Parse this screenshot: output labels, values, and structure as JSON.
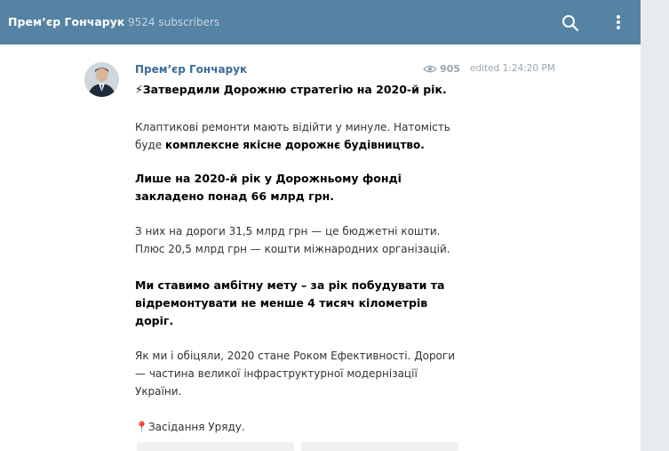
{
  "header": {
    "channel_title": "Прем’єр Гончарук",
    "subscribers": "9524 subscribers",
    "search_icon": "search-icon",
    "menu_icon": "more-vertical-icon",
    "background_color": "#5682a3"
  },
  "post": {
    "author": "Прем’єр Гончарук",
    "views": "905",
    "edited": "edited 1:24:20 PM",
    "heading_emoji": "⚡",
    "heading_text": "Затвердили Дорожню стратегію на 2020-й рік.",
    "para1_line1": "Клаптикові ремонти мають відійти у минуле. Натомість",
    "para1_line2_start": "буде ",
    "para1_line2_bold": "комплексне якісне дорожнє будівництво.",
    "para2_line1": "Лише на 2020-й рік у Дорожньому фонді",
    "para2_line2": "закладено понад 66 млрд грн.",
    "para3_line1": "З них на дороги 31,5 млрд грн — це бюджетні кошти.",
    "para3_line2": "Плюс 20,5 млрд грн — кошти міжнародних організацій.",
    "para4_line1": "Ми ставимо амбітну мету – за рік побудувати та",
    "para4_line2": "відремонтувати не менше 4 тисяч кілометрів",
    "para4_line3": "доріг.",
    "para5_line1": "Як ми і обіцяли, 2020 стане Роком Ефективності. Дороги",
    "para5_line2": "— частина великої інфраструктурної модернізації",
    "para5_line3": "України.",
    "location_emoji": "📍",
    "location_text": "Засідання Уряду."
  }
}
